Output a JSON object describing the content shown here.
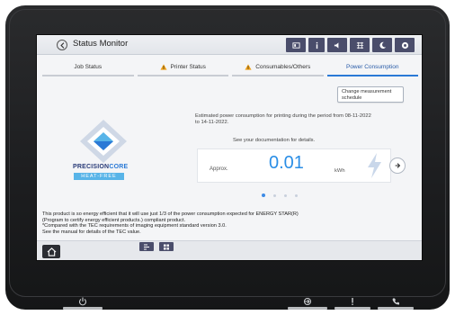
{
  "window": {
    "title": "Status Monitor",
    "icons": [
      "id-card-icon",
      "speaker-icon",
      "network-icon",
      "moon-icon",
      "help-icon"
    ]
  },
  "tabs": [
    {
      "label": "Job Status",
      "warning": false,
      "active": false
    },
    {
      "label": "Printer Status",
      "warning": true,
      "active": false
    },
    {
      "label": "Consumables/Others",
      "warning": true,
      "active": false
    },
    {
      "label": "Power Consumption",
      "warning": false,
      "active": true
    }
  ],
  "content": {
    "change_schedule_button": "Change measurement schedule",
    "estimate_text": "Estimated power consumption for printing during the period from 08-11-2022 to 14-11-2022.",
    "doc_note": "See your documentation for details.",
    "approx_label": "Approx.",
    "value": "0.01",
    "unit": "kWh",
    "logo": {
      "word_a": "PRECISION",
      "word_b": "CORE",
      "band": "HEAT-FREE"
    },
    "pager": {
      "count": 4,
      "active": 0
    },
    "footnote": [
      "This product is so energy efficient that it will use just 1/3 of the power consumption expected for ENERGY STAR(R)",
      "(Program to certify energy efficient products.) compliant product.",
      "*Compared with the TEC requirements of imaging equipment standard version 3.0.",
      "See the manual for details of the TEC value."
    ]
  },
  "colors": {
    "accent": "#2a79d6",
    "value": "#2a8ee6",
    "toolbar_icon_bg": "#4a4d6b",
    "warning": "#f0a218"
  }
}
